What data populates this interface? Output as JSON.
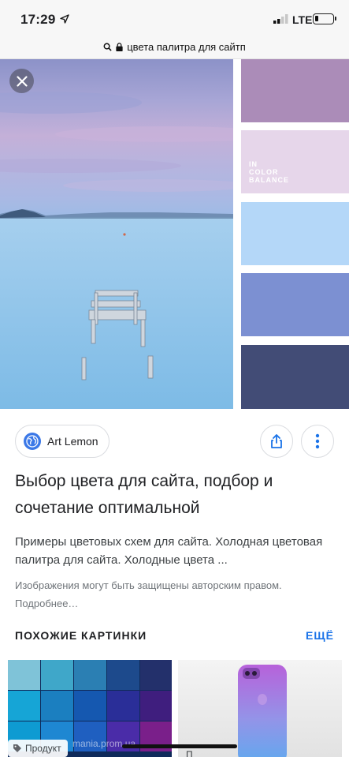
{
  "status_bar": {
    "time": "17:29",
    "network": "LTE",
    "battery_level": 0.2
  },
  "browser": {
    "url_text": "цвета палитра для сайтп",
    "icons": [
      "search-icon",
      "lock-icon"
    ]
  },
  "viewer": {
    "close_icon": "close-icon",
    "palette": {
      "swatches": [
        "#ab8cb8",
        "#e6d6ea",
        "#b4d7f8",
        "#7c90d2",
        "#424c76"
      ],
      "label_lines": [
        "IN",
        "COLOR",
        "BALANCE"
      ]
    }
  },
  "result": {
    "source_name": "Art Lemon",
    "title": "Выбор цвета для сайта, подбор и сочетание оптимальной",
    "description": "Примеры цветовых схем для сайта. Холодная цветовая палитра для сайта. Холодные цвета ...",
    "copyright_notice": "Изображения могут быть защищены авторским правом. Подробнее…"
  },
  "similar": {
    "heading": "ПОХОЖИЕ КАРТИНКИ",
    "more_label": "ЕЩЁ",
    "items": [
      {
        "badge": "Продукт",
        "watermark": "mania.prom.ua"
      },
      {
        "badge": "П"
      }
    ]
  },
  "colors": {
    "link_blue": "#1a73e8",
    "source_globe": "#3b78e7"
  }
}
